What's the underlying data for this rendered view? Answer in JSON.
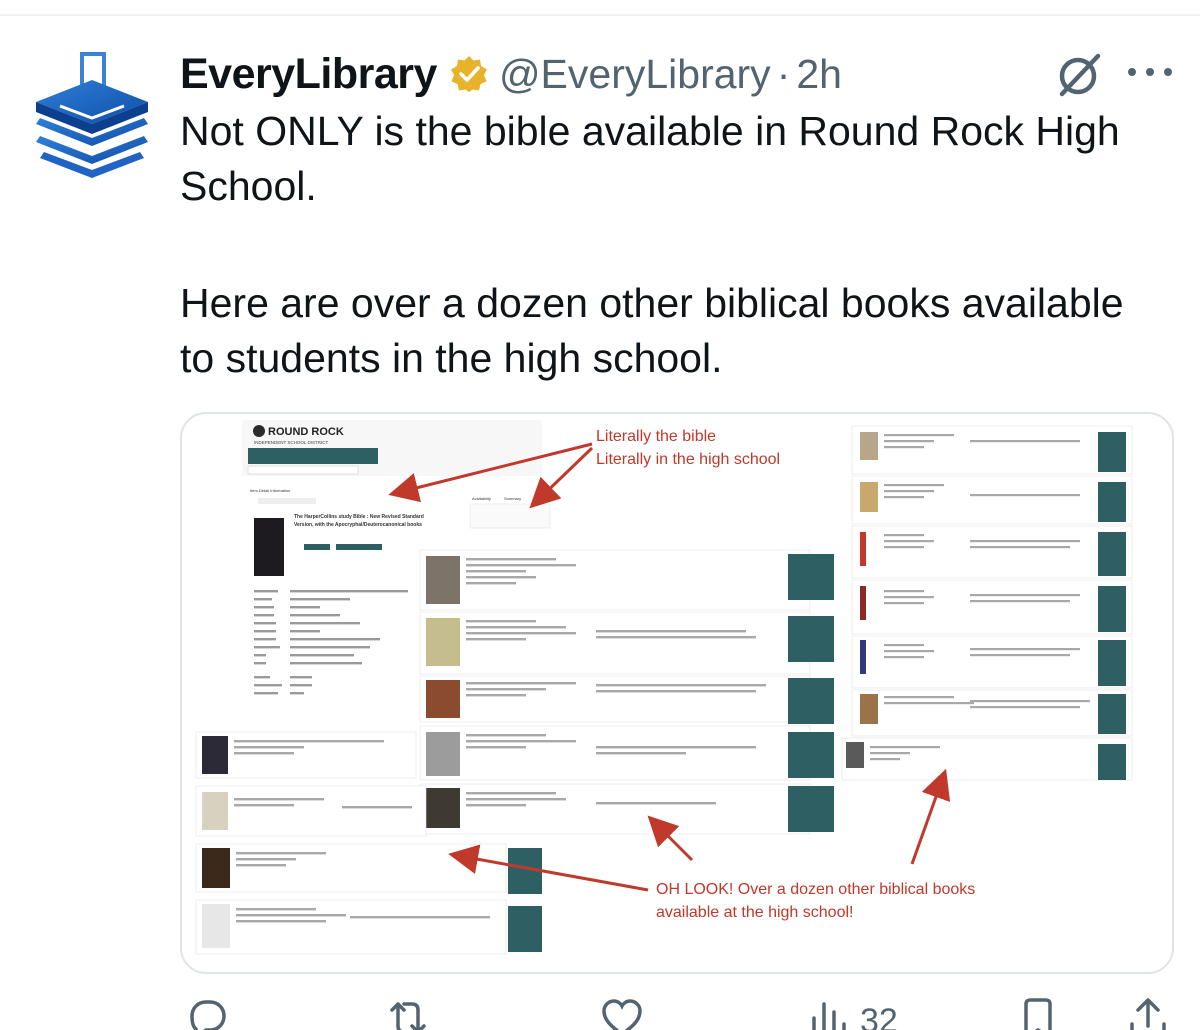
{
  "tweet": {
    "display_name": "EveryLibrary",
    "handle": "@EveryLibrary",
    "separator": "·",
    "time": "2h",
    "text_line1": "Not ONLY is the bible available in Round Rock High School.",
    "text_line2": "Here are over a dozen other biblical books available to students in the high school."
  },
  "media": {
    "logo_title": "ROUND ROCK",
    "logo_subtitle": "INDEPENDENT SCHOOL DISTRICT",
    "annotation_top_1": "Literally the bible",
    "annotation_top_2": "Literally in the high school",
    "annotation_bottom_1": "OH LOOK! Over a dozen other biblical books",
    "annotation_bottom_2": "available at the high school!",
    "main_book_title_1": "The HarperCollins study Bible : New Revised Standard",
    "main_book_title_2": "Version, with the Apocryphal/Deuterocanonical books",
    "availability_tab": "Availability",
    "summary_tab": "Summary",
    "accent_color": "#c0392b",
    "button_color": "#2e5f63"
  },
  "actions": {
    "reply_icon": "reply-icon",
    "retweet_icon": "retweet-icon",
    "like_icon": "heart-icon",
    "views_icon": "views-icon",
    "views_count": "32",
    "bookmark_icon": "bookmark-icon",
    "share_icon": "share-icon"
  }
}
